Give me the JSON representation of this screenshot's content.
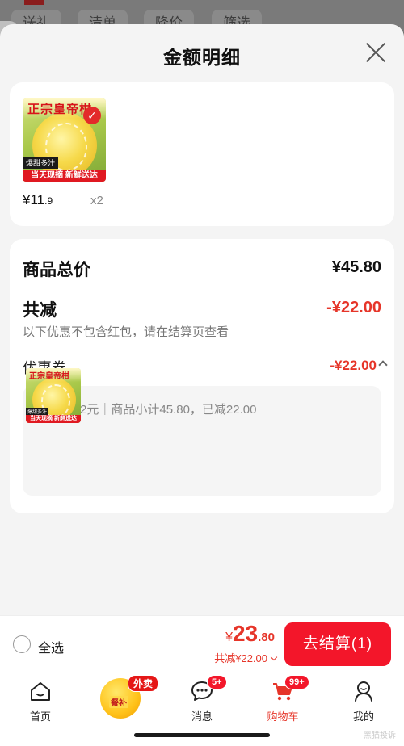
{
  "background": {
    "filters": [
      "送礼",
      "清单",
      "降价",
      "筛选"
    ]
  },
  "sheet": {
    "title": "金额明细"
  },
  "product": {
    "image_head": "正宗皇帝柑",
    "image_tag": "爆甜多汁",
    "image_foot": "当天现摘 新鲜送达",
    "price_symbol": "¥",
    "price_int": "11",
    "price_dec": ".9",
    "quantity": "x2"
  },
  "summary": {
    "total_label": "商品总价",
    "total_value": "¥45.80",
    "reduce_label": "共减",
    "reduce_value": "-¥22.00",
    "reduce_note": "以下优惠不包含红包，请在结算页查看",
    "coupon_label": "优惠券",
    "coupon_value": "-¥22.00",
    "coupon_detail": "满45减22元｜商品小计45.80，已减22.00"
  },
  "checkout": {
    "select_all": "全选",
    "price_symbol": "¥",
    "price_int": "23",
    "price_dec": ".80",
    "reduce_text": "共减¥22.00",
    "pay_button": "去结算(1)"
  },
  "tabbar": {
    "home": "首页",
    "takeaway_badge": "外卖",
    "takeaway_orb": "餐补",
    "messages": "消息",
    "messages_badge": "5+",
    "cart": "购物车",
    "cart_badge": "99+",
    "me": "我的"
  },
  "watermark": "黑猫投诉",
  "colors": {
    "accent_red": "#f3162a",
    "discount_red": "#e63529",
    "sheet_bg": "#f4f4f4"
  }
}
